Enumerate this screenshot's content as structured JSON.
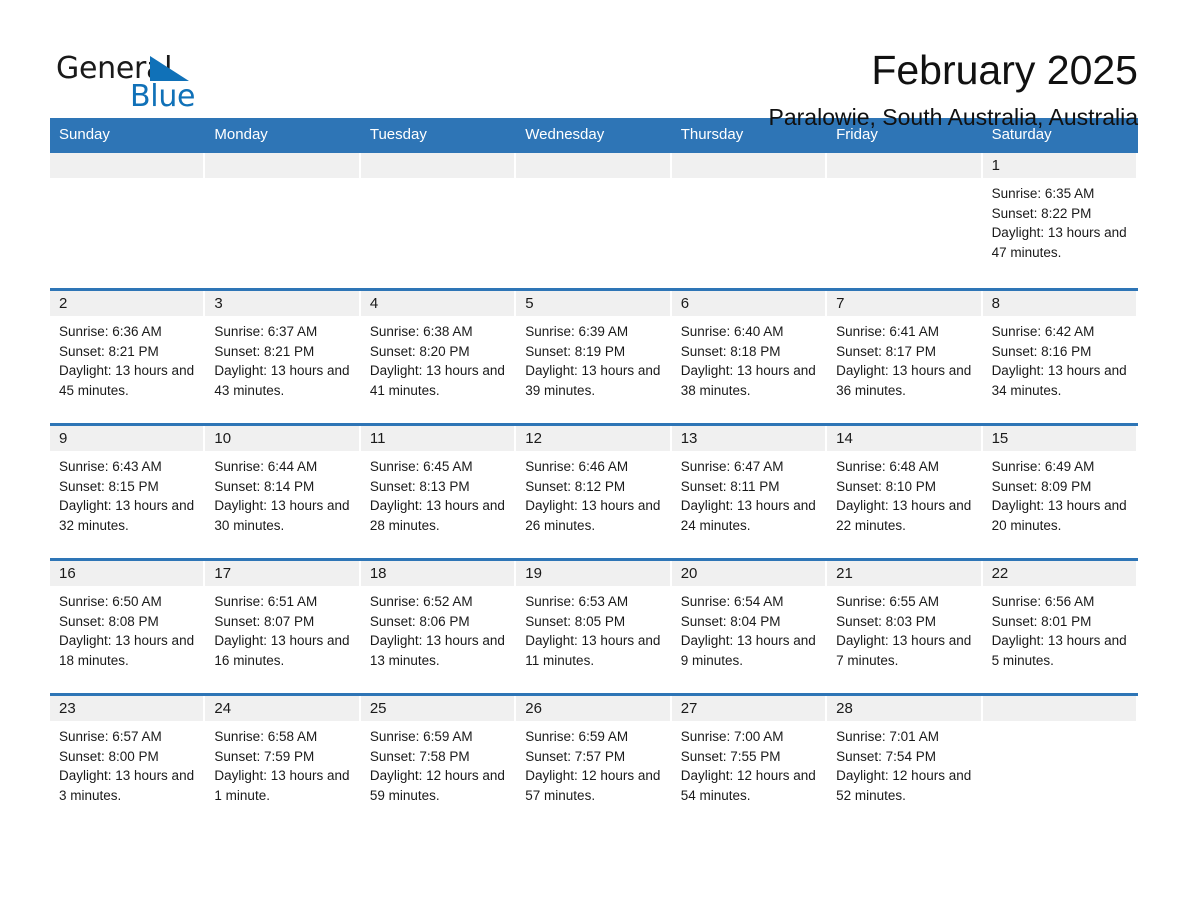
{
  "brand": {
    "word_one": "General",
    "word_two": "Blue",
    "accent_color": "#1071B8"
  },
  "header": {
    "title": "February 2025",
    "subtitle": "Paralowie, South Australia, Australia"
  },
  "theme": {
    "header_blue": "#2E75B6",
    "date_band_gray": "#f0f0f0",
    "text": "#1a1a1a"
  },
  "weekdays": [
    "Sunday",
    "Monday",
    "Tuesday",
    "Wednesday",
    "Thursday",
    "Friday",
    "Saturday"
  ],
  "weeks": [
    [
      {
        "day": "",
        "empty": true
      },
      {
        "day": "",
        "empty": true
      },
      {
        "day": "",
        "empty": true
      },
      {
        "day": "",
        "empty": true
      },
      {
        "day": "",
        "empty": true
      },
      {
        "day": "",
        "empty": true
      },
      {
        "day": "1",
        "sunrise": "Sunrise: 6:35 AM",
        "sunset": "Sunset: 8:22 PM",
        "daylight": "Daylight: 13 hours and 47 minutes."
      }
    ],
    [
      {
        "day": "2",
        "sunrise": "Sunrise: 6:36 AM",
        "sunset": "Sunset: 8:21 PM",
        "daylight": "Daylight: 13 hours and 45 minutes."
      },
      {
        "day": "3",
        "sunrise": "Sunrise: 6:37 AM",
        "sunset": "Sunset: 8:21 PM",
        "daylight": "Daylight: 13 hours and 43 minutes."
      },
      {
        "day": "4",
        "sunrise": "Sunrise: 6:38 AM",
        "sunset": "Sunset: 8:20 PM",
        "daylight": "Daylight: 13 hours and 41 minutes."
      },
      {
        "day": "5",
        "sunrise": "Sunrise: 6:39 AM",
        "sunset": "Sunset: 8:19 PM",
        "daylight": "Daylight: 13 hours and 39 minutes."
      },
      {
        "day": "6",
        "sunrise": "Sunrise: 6:40 AM",
        "sunset": "Sunset: 8:18 PM",
        "daylight": "Daylight: 13 hours and 38 minutes."
      },
      {
        "day": "7",
        "sunrise": "Sunrise: 6:41 AM",
        "sunset": "Sunset: 8:17 PM",
        "daylight": "Daylight: 13 hours and 36 minutes."
      },
      {
        "day": "8",
        "sunrise": "Sunrise: 6:42 AM",
        "sunset": "Sunset: 8:16 PM",
        "daylight": "Daylight: 13 hours and 34 minutes."
      }
    ],
    [
      {
        "day": "9",
        "sunrise": "Sunrise: 6:43 AM",
        "sunset": "Sunset: 8:15 PM",
        "daylight": "Daylight: 13 hours and 32 minutes."
      },
      {
        "day": "10",
        "sunrise": "Sunrise: 6:44 AM",
        "sunset": "Sunset: 8:14 PM",
        "daylight": "Daylight: 13 hours and 30 minutes."
      },
      {
        "day": "11",
        "sunrise": "Sunrise: 6:45 AM",
        "sunset": "Sunset: 8:13 PM",
        "daylight": "Daylight: 13 hours and 28 minutes."
      },
      {
        "day": "12",
        "sunrise": "Sunrise: 6:46 AM",
        "sunset": "Sunset: 8:12 PM",
        "daylight": "Daylight: 13 hours and 26 minutes."
      },
      {
        "day": "13",
        "sunrise": "Sunrise: 6:47 AM",
        "sunset": "Sunset: 8:11 PM",
        "daylight": "Daylight: 13 hours and 24 minutes."
      },
      {
        "day": "14",
        "sunrise": "Sunrise: 6:48 AM",
        "sunset": "Sunset: 8:10 PM",
        "daylight": "Daylight: 13 hours and 22 minutes."
      },
      {
        "day": "15",
        "sunrise": "Sunrise: 6:49 AM",
        "sunset": "Sunset: 8:09 PM",
        "daylight": "Daylight: 13 hours and 20 minutes."
      }
    ],
    [
      {
        "day": "16",
        "sunrise": "Sunrise: 6:50 AM",
        "sunset": "Sunset: 8:08 PM",
        "daylight": "Daylight: 13 hours and 18 minutes."
      },
      {
        "day": "17",
        "sunrise": "Sunrise: 6:51 AM",
        "sunset": "Sunset: 8:07 PM",
        "daylight": "Daylight: 13 hours and 16 minutes."
      },
      {
        "day": "18",
        "sunrise": "Sunrise: 6:52 AM",
        "sunset": "Sunset: 8:06 PM",
        "daylight": "Daylight: 13 hours and 13 minutes."
      },
      {
        "day": "19",
        "sunrise": "Sunrise: 6:53 AM",
        "sunset": "Sunset: 8:05 PM",
        "daylight": "Daylight: 13 hours and 11 minutes."
      },
      {
        "day": "20",
        "sunrise": "Sunrise: 6:54 AM",
        "sunset": "Sunset: 8:04 PM",
        "daylight": "Daylight: 13 hours and 9 minutes."
      },
      {
        "day": "21",
        "sunrise": "Sunrise: 6:55 AM",
        "sunset": "Sunset: 8:03 PM",
        "daylight": "Daylight: 13 hours and 7 minutes."
      },
      {
        "day": "22",
        "sunrise": "Sunrise: 6:56 AM",
        "sunset": "Sunset: 8:01 PM",
        "daylight": "Daylight: 13 hours and 5 minutes."
      }
    ],
    [
      {
        "day": "23",
        "sunrise": "Sunrise: 6:57 AM",
        "sunset": "Sunset: 8:00 PM",
        "daylight": "Daylight: 13 hours and 3 minutes."
      },
      {
        "day": "24",
        "sunrise": "Sunrise: 6:58 AM",
        "sunset": "Sunset: 7:59 PM",
        "daylight": "Daylight: 13 hours and 1 minute."
      },
      {
        "day": "25",
        "sunrise": "Sunrise: 6:59 AM",
        "sunset": "Sunset: 7:58 PM",
        "daylight": "Daylight: 12 hours and 59 minutes."
      },
      {
        "day": "26",
        "sunrise": "Sunrise: 6:59 AM",
        "sunset": "Sunset: 7:57 PM",
        "daylight": "Daylight: 12 hours and 57 minutes."
      },
      {
        "day": "27",
        "sunrise": "Sunrise: 7:00 AM",
        "sunset": "Sunset: 7:55 PM",
        "daylight": "Daylight: 12 hours and 54 minutes."
      },
      {
        "day": "28",
        "sunrise": "Sunrise: 7:01 AM",
        "sunset": "Sunset: 7:54 PM",
        "daylight": "Daylight: 12 hours and 52 minutes."
      },
      {
        "day": "",
        "empty": true
      }
    ]
  ]
}
